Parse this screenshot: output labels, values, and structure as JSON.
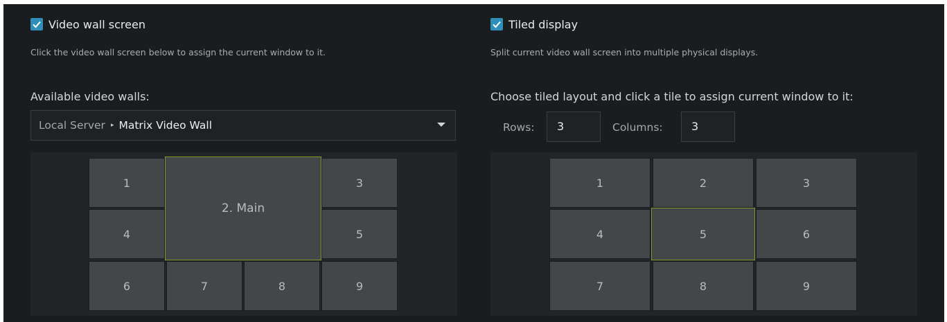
{
  "left": {
    "checkbox_label": "Video wall screen",
    "checked": true,
    "hint": "Click the video wall screen below to assign the current window to it.",
    "section_title": "Available video walls:",
    "dropdown": {
      "server": "Local Server",
      "separator": "▸",
      "wall": "Matrix Video Wall"
    },
    "tiles": [
      "1",
      "2. Main",
      "3",
      "4",
      "5",
      "6",
      "7",
      "8",
      "9"
    ],
    "selected_tile": "2. Main"
  },
  "right": {
    "checkbox_label": "Tiled display",
    "checked": true,
    "hint": "Split current video wall screen into multiple physical displays.",
    "section_title": "Choose tiled layout and click a tile to assign current window to it:",
    "rows_label": "Rows:",
    "rows_value": "3",
    "columns_label": "Columns:",
    "columns_value": "3",
    "tiles": [
      "1",
      "2",
      "3",
      "4",
      "5",
      "6",
      "7",
      "8",
      "9"
    ],
    "selected_tile": "5"
  },
  "colors": {
    "accent_checkbox": "#2f8fb9",
    "selected_border": "#8a9630",
    "tile_bg": "#43474a",
    "panel_bg": "#1a1d20"
  }
}
